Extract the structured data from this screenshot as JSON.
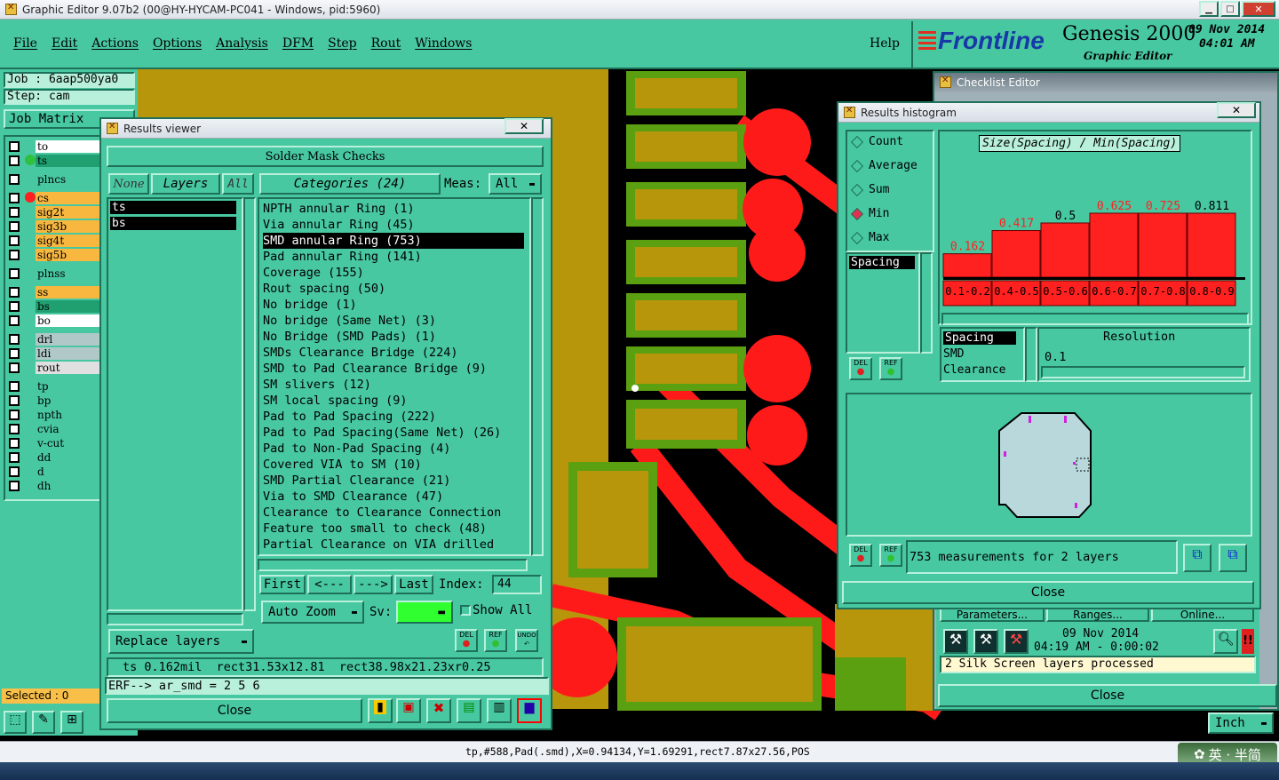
{
  "window": {
    "title": "Graphic Editor 9.07b2 (00@HY-HYCAM-PC041 - Windows, pid:5960)"
  },
  "menu": {
    "items": [
      "File",
      "Edit",
      "Actions",
      "Options",
      "Analysis",
      "DFM",
      "Step",
      "Rout",
      "Windows"
    ],
    "help": "Help"
  },
  "brand": {
    "logo": "Frontline",
    "product": "Genesis 2000",
    "subtitle": "Graphic Editor",
    "date": "09 Nov 2014",
    "time": "04:01 AM"
  },
  "job": {
    "job": "Job  : 6aap500ya0",
    "step": "Step: cam",
    "matrix": "Job Matrix"
  },
  "layers": [
    {
      "name": "to",
      "color": "#ffffff",
      "dot": ""
    },
    {
      "name": "ts",
      "color": "#20a070",
      "dot": "#30c040"
    },
    {
      "name": "plncs",
      "color": "#48c8a0",
      "dot": ""
    },
    {
      "name": "cs",
      "color": "#f8b840",
      "dot": "#ff2020"
    },
    {
      "name": "sig2t",
      "color": "#f8b840",
      "dot": ""
    },
    {
      "name": "sig3b",
      "color": "#f8b840",
      "dot": ""
    },
    {
      "name": "sig4t",
      "color": "#f8b840",
      "dot": ""
    },
    {
      "name": "sig5b",
      "color": "#f8b840",
      "dot": ""
    },
    {
      "name": "plnss",
      "color": "#48c8a0",
      "dot": ""
    },
    {
      "name": "ss",
      "color": "#f8b840",
      "dot": ""
    },
    {
      "name": "bs",
      "color": "#20a070",
      "dot": ""
    },
    {
      "name": "bo",
      "color": "#ffffff",
      "dot": ""
    },
    {
      "name": "drl",
      "color": "#b0c8c8",
      "dot": ""
    },
    {
      "name": "ldi",
      "color": "#b0c8c8",
      "dot": ""
    },
    {
      "name": "rout",
      "color": "#e0e0e0",
      "dot": ""
    },
    {
      "name": "tp",
      "color": "#48c8a0",
      "dot": ""
    },
    {
      "name": "bp",
      "color": "#48c8a0",
      "dot": ""
    },
    {
      "name": "npth",
      "color": "#48c8a0",
      "dot": ""
    },
    {
      "name": "cvia",
      "color": "#48c8a0",
      "dot": ""
    },
    {
      "name": "v-cut",
      "color": "#48c8a0",
      "dot": ""
    },
    {
      "name": "dd",
      "color": "#48c8a0",
      "dot": ""
    },
    {
      "name": "d",
      "color": "#48c8a0",
      "dot": ""
    },
    {
      "name": "dh",
      "color": "#48c8a0",
      "dot": ""
    }
  ],
  "selected": "Selected : 0",
  "results_viewer": {
    "title": "Results viewer",
    "header": "Solder Mask Checks",
    "none": "None",
    "layers": "Layers",
    "all": "All",
    "categories_label": "Categories (24)",
    "meas_label": "Meas:",
    "meas_value": "All",
    "layer_list": [
      "ts",
      "bs"
    ],
    "categories": [
      "NPTH annular Ring (1)",
      "Via annular Ring (45)",
      "SMD annular Ring (753)",
      "Pad annular Ring (141)",
      "Coverage (155)",
      "Rout spacing (50)",
      "No bridge (1)",
      "No bridge (Same Net) (3)",
      "No Bridge (SMD Pads) (1)",
      "SMDs Clearance Bridge (224)",
      "SMD to Pad Clearance Bridge (9)",
      "SM slivers (12)",
      "SM local spacing (9)",
      "Pad to Pad Spacing (222)",
      "Pad to Pad Spacing(Same Net) (26)",
      "Pad to Non-Pad Spacing (4)",
      "Covered VIA to SM (10)",
      "SMD Partial Clearance (21)",
      "Via to SMD Clearance (47)",
      "Clearance to Clearance Connection",
      "Feature too small to check (48)",
      "Partial Clearance on VIA drilled"
    ],
    "selected_index": 2,
    "first": "First",
    "prev": "<---",
    "next": "--->",
    "last": "Last",
    "index_label": "Index:",
    "index_value": "44",
    "auto_zoom": "Auto Zoom",
    "sv": "Sv:",
    "show_all": "Show All",
    "replace_layers": "Replace layers",
    "del": "DEL",
    "ref": "REF",
    "undo": "UNDO",
    "info": "ts 0.162mil  rect31.53x12.81  rect38.98x21.23xr0.25",
    "erf": "ERF--> ar_smd = 2 5 6",
    "close": "Close"
  },
  "checklist": {
    "title": "Checklist Editor",
    "parameters": "Parameters...",
    "ranges": "Ranges...",
    "online": "Online...",
    "date": "09 Nov 2014",
    "time": "04:19 AM - 0:00:02",
    "status": "2 Silk Screen layers processed",
    "close": "Close"
  },
  "histogram": {
    "title": "Results histogram",
    "options": [
      "Count",
      "Average",
      "Sum",
      "Min",
      "Max"
    ],
    "selected_option": "Min",
    "chart_title": "Size(Spacing) / Min(Spacing)",
    "left_list": [
      "Spacing"
    ],
    "right_list": [
      "Spacing",
      "SMD",
      "Clearance"
    ],
    "resolution_label": "Resolution",
    "resolution_value": "0.1",
    "summary": "753 measurements for 2 layers",
    "del": "DEL",
    "ref": "REF",
    "close": "Close"
  },
  "chart_data": {
    "type": "bar",
    "title": "Size(Spacing) / Min(Spacing)",
    "categories": [
      "0.1-0.2",
      "0.4-0.5",
      "0.5-0.6",
      "0.6-0.7",
      "0.7-0.8",
      "0.8-0.9"
    ],
    "values": [
      0.162,
      0.417,
      0.5,
      0.625,
      0.725,
      0.811
    ],
    "value_labels": [
      "0.162",
      "0.417",
      "0.5",
      "0.625",
      "0.725",
      "0.811"
    ],
    "ylim": [
      0,
      0.9
    ],
    "color": "#ff2020"
  },
  "units": "Inch",
  "statusbar": "tp,#588,Pad(.smd),X=0.94134,Y=1.69291,rect7.87x27.56,POS",
  "ime": "英 · 半简"
}
